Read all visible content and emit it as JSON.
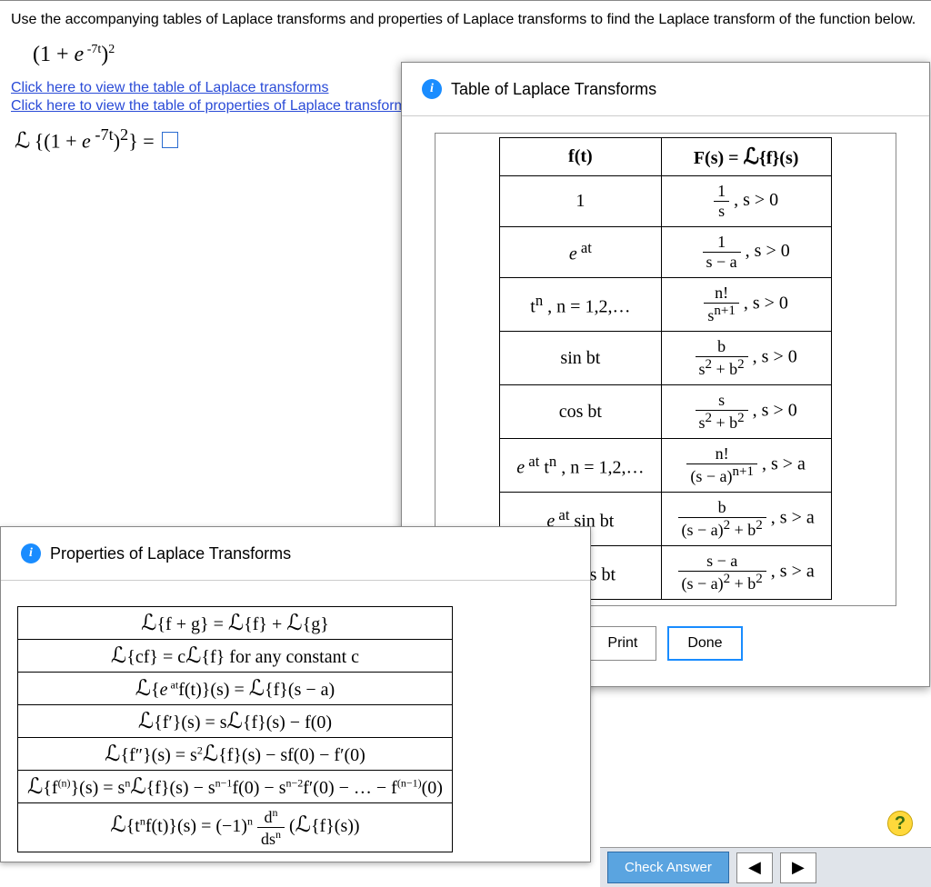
{
  "question": {
    "prompt": "Use the accompanying tables of Laplace transforms and properties of Laplace transforms to find the Laplace transform of the function below.",
    "expression": "(1 + e^{-7t})^2",
    "link_table": "Click here to view the table of Laplace transforms",
    "link_props": "Click here to view the table of properties of Laplace transforms.",
    "answer_lhs": "ℒ{(1 + e^{-7t})^2} ="
  },
  "laplace_panel": {
    "title": "Table of Laplace Transforms",
    "col_ft": "f(t)",
    "col_Fs": "F(s) = ℒ{f}(s)",
    "rows": [
      {
        "ft": "1",
        "Fs": "1/s , s>0"
      },
      {
        "ft": "e^{at}",
        "Fs": "1/(s−a) , s>0"
      },
      {
        "ft": "t^n , n=1,2,…",
        "Fs": "n!/s^{n+1} , s>0"
      },
      {
        "ft": "sin bt",
        "Fs": "b/(s^2+b^2) , s>0"
      },
      {
        "ft": "cos bt",
        "Fs": "s/(s^2+b^2) , s>0"
      },
      {
        "ft": "e^{at} t^n , n=1,2,…",
        "Fs": "n!/(s−a)^{n+1} , s>a"
      },
      {
        "ft": "e^{at} sin bt",
        "Fs": "b/((s−a)^2+b^2) , s>a"
      },
      {
        "ft": "e^{at} cos bt",
        "Fs": "(s−a)/((s−a)^2+b^2) , s>a"
      }
    ],
    "print_btn": "Print",
    "done_btn": "Done"
  },
  "props_panel": {
    "title": "Properties of Laplace Transforms",
    "rows": [
      "ℒ{f+g} = ℒ{f} + ℒ{g}",
      "ℒ{cf} = cℒ{f} for any constant c",
      "ℒ{e^{at}f(t)}(s) = ℒ{f}(s−a)",
      "ℒ{f′}(s) = sℒ{f}(s) − f(0)",
      "ℒ{f″}(s) = s^2 ℒ{f}(s) − sf(0) − f′(0)",
      "ℒ{f^{(n)}}(s) = s^n ℒ{f}(s) − s^{n−1}f(0) − s^{n−2}f′(0) − … − f^{(n−1)}(0)",
      "ℒ{t^n f(t)}(s) = (−1)^n d^n/ds^n (ℒ{f}(s))"
    ]
  },
  "footer": {
    "check": "Check Answer",
    "prev": "◀",
    "next": "▶",
    "help": "?"
  }
}
